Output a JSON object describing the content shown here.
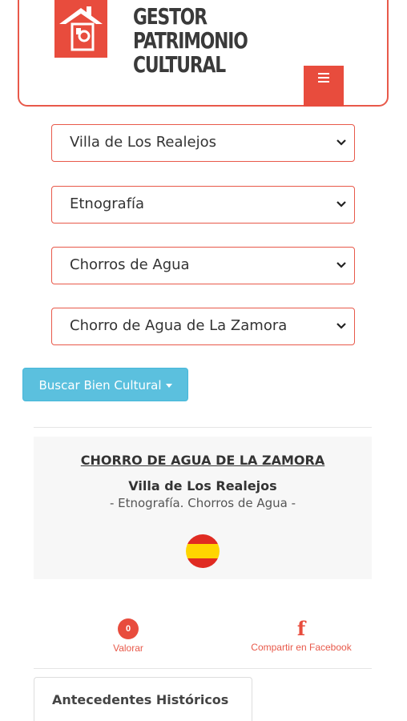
{
  "header": {
    "brand_line1": "GESTOR PATRIMONIO",
    "brand_line2": "CULTURAL",
    "menu_icon": "hamburger-menu-icon",
    "accent_color": "#e84c3d"
  },
  "filters": {
    "municipio": "Villa de Los Realejos",
    "categoria": "Etnografía",
    "subcategoria": "Chorros de Agua",
    "bien": "Chorro de Agua de La Zamora"
  },
  "search_button": {
    "label": "Buscar Bien Cultural"
  },
  "card": {
    "title": "CHORRO DE AGUA DE LA ZAMORA",
    "municipality": "Villa de Los Realejos",
    "category_line": "- Etnografía. Chorros de Agua -",
    "language_flag": "spain-flag-icon"
  },
  "actions": {
    "rate_count": "0",
    "rate_label": "Valorar",
    "facebook_label": "Compartir en Facebook"
  },
  "tabs": {
    "active": "Antecedentes Históricos"
  }
}
